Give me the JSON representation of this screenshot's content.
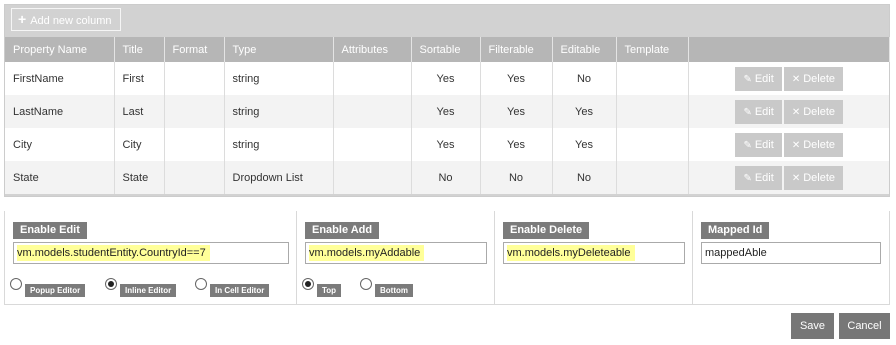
{
  "toolbar": {
    "add_label": "Add new column"
  },
  "table": {
    "headers": [
      "Property Name",
      "Title",
      "Format",
      "Type",
      "Attributes",
      "Sortable",
      "Filterable",
      "Editable",
      "Template",
      ""
    ],
    "rows": [
      {
        "property": "FirstName",
        "title": "First",
        "format": "",
        "type": "string",
        "attributes": "",
        "sortable": "Yes",
        "filterable": "Yes",
        "editable": "No",
        "template": ""
      },
      {
        "property": "LastName",
        "title": "Last",
        "format": "",
        "type": "string",
        "attributes": "",
        "sortable": "Yes",
        "filterable": "Yes",
        "editable": "Yes",
        "template": ""
      },
      {
        "property": "City",
        "title": "City",
        "format": "",
        "type": "string",
        "attributes": "",
        "sortable": "Yes",
        "filterable": "Yes",
        "editable": "Yes",
        "template": ""
      },
      {
        "property": "State",
        "title": "State",
        "format": "",
        "type": "Dropdown List",
        "attributes": "",
        "sortable": "No",
        "filterable": "No",
        "editable": "No",
        "template": ""
      }
    ],
    "edit_label": "Edit",
    "delete_label": "Delete"
  },
  "panels": {
    "edit": {
      "label": "Enable Edit",
      "value": "vm.models.studentEntity.CountryId==7",
      "options": [
        {
          "label": "Popup Editor",
          "selected": false
        },
        {
          "label": "Inline Editor",
          "selected": true
        },
        {
          "label": "In Cell Editor",
          "selected": false
        }
      ]
    },
    "add": {
      "label": "Enable Add",
      "value": "vm.models.myAddable",
      "options": [
        {
          "label": "Top",
          "selected": true
        },
        {
          "label": "Bottom",
          "selected": false
        }
      ]
    },
    "delete": {
      "label": "Enable Delete",
      "value": "vm.models.myDeleteable"
    },
    "mapped": {
      "label": "Mapped Id",
      "value": "mappedAble"
    }
  },
  "footer": {
    "save_label": "Save",
    "cancel_label": "Cancel"
  },
  "colors": {
    "toolbar_bg": "#d2d2d2",
    "header_bg": "#b6b6b6",
    "label_bg": "#7b7b7b",
    "highlight": "#ffff99",
    "footer_button": "#777777"
  }
}
